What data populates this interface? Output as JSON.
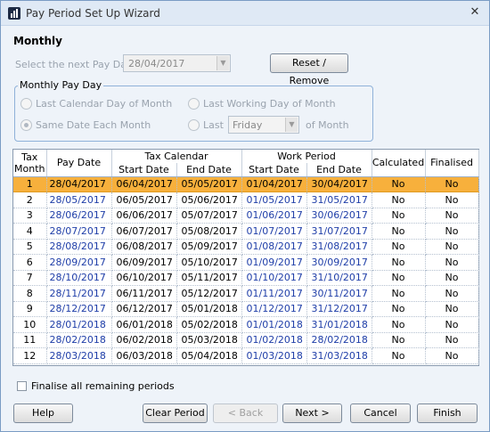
{
  "window": {
    "title": "Pay Period Set Up Wizard",
    "close_icon": "close-icon"
  },
  "heading": "Monthly",
  "next_pay_date": {
    "label": "Select the next Pay Date",
    "value": "28/04/2017"
  },
  "reset_button": "Reset / Remove",
  "monthly_pay_day": {
    "title": "Monthly Pay Day",
    "opt_last_calendar": "Last Calendar Day of Month",
    "opt_last_working": "Last Working Day of Month",
    "opt_same_date": "Same Date Each Month",
    "opt_last": "Last",
    "day_value": "Friday",
    "of_month": "of Month"
  },
  "table": {
    "headers": {
      "tax_month_1": "Tax",
      "tax_month_2": "Month",
      "pay_date": "Pay Date",
      "tax_calendar": "Tax Calendar",
      "start_date": "Start Date",
      "end_date": "End Date",
      "work_period": "Work Period",
      "calculated": "Calculated",
      "finalised": "Finalised"
    },
    "rows": [
      [
        "1",
        "28/04/2017",
        "06/04/2017",
        "05/05/2017",
        "01/04/2017",
        "30/04/2017",
        "No",
        "No"
      ],
      [
        "2",
        "28/05/2017",
        "06/05/2017",
        "05/06/2017",
        "01/05/2017",
        "31/05/2017",
        "No",
        "No"
      ],
      [
        "3",
        "28/06/2017",
        "06/06/2017",
        "05/07/2017",
        "01/06/2017",
        "30/06/2017",
        "No",
        "No"
      ],
      [
        "4",
        "28/07/2017",
        "06/07/2017",
        "05/08/2017",
        "01/07/2017",
        "31/07/2017",
        "No",
        "No"
      ],
      [
        "5",
        "28/08/2017",
        "06/08/2017",
        "05/09/2017",
        "01/08/2017",
        "31/08/2017",
        "No",
        "No"
      ],
      [
        "6",
        "28/09/2017",
        "06/09/2017",
        "05/10/2017",
        "01/09/2017",
        "30/09/2017",
        "No",
        "No"
      ],
      [
        "7",
        "28/10/2017",
        "06/10/2017",
        "05/11/2017",
        "01/10/2017",
        "31/10/2017",
        "No",
        "No"
      ],
      [
        "8",
        "28/11/2017",
        "06/11/2017",
        "05/12/2017",
        "01/11/2017",
        "30/11/2017",
        "No",
        "No"
      ],
      [
        "9",
        "28/12/2017",
        "06/12/2017",
        "05/01/2018",
        "01/12/2017",
        "31/12/2017",
        "No",
        "No"
      ],
      [
        "10",
        "28/01/2018",
        "06/01/2018",
        "05/02/2018",
        "01/01/2018",
        "31/01/2018",
        "No",
        "No"
      ],
      [
        "11",
        "28/02/2018",
        "06/02/2018",
        "05/03/2018",
        "01/02/2018",
        "28/02/2018",
        "No",
        "No"
      ],
      [
        "12",
        "28/03/2018",
        "06/03/2018",
        "05/04/2018",
        "01/03/2018",
        "31/03/2018",
        "No",
        "No"
      ]
    ],
    "selected_row": 0
  },
  "finalise_checkbox": "Finalise all remaining periods",
  "buttons": {
    "help": "Help",
    "clear_period": "Clear Period",
    "back": "< Back",
    "next": "Next >",
    "cancel": "Cancel",
    "finish": "Finish"
  },
  "colors": {
    "selected_row": "#f7b03c",
    "link_blue": "#1f3ea8",
    "group_border": "#8fb1d9"
  }
}
